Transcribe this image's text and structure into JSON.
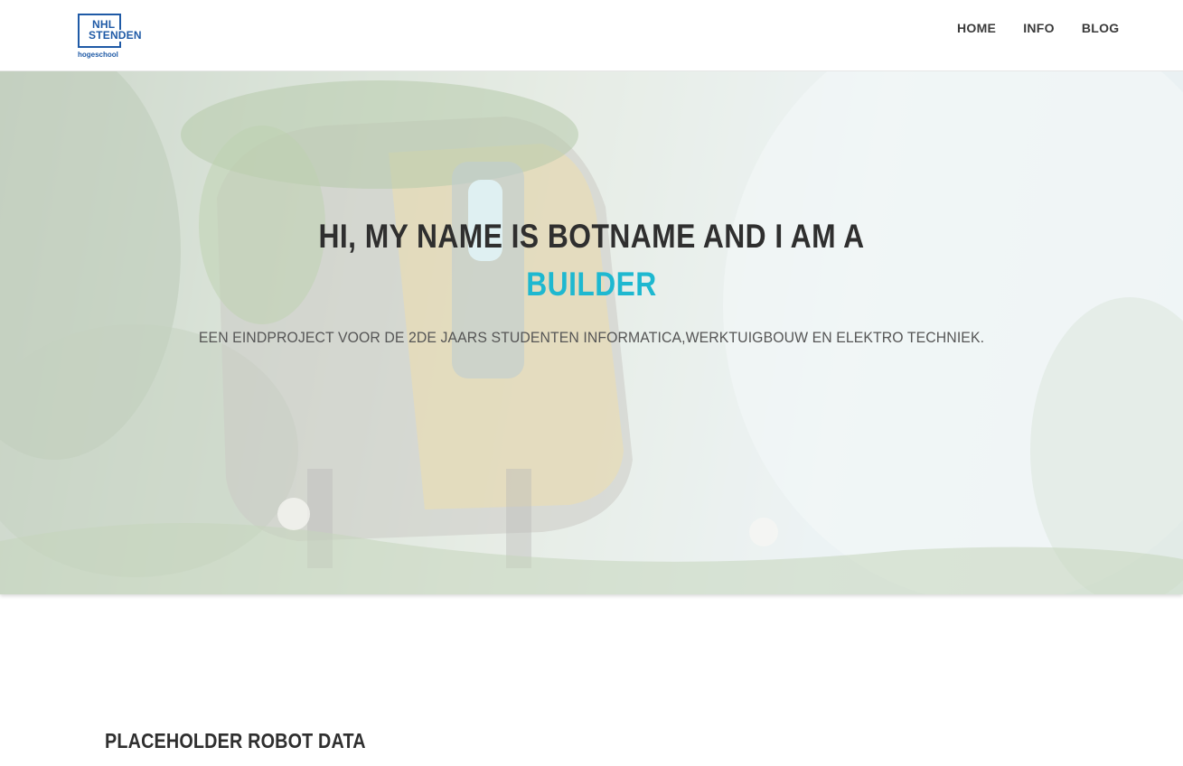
{
  "header": {
    "logo": {
      "line1": "NHL",
      "line2": "STENDEN",
      "line3": "hogeschool"
    },
    "nav": [
      {
        "label": "HOME"
      },
      {
        "label": "INFO"
      },
      {
        "label": "BLOG"
      }
    ]
  },
  "hero": {
    "title": "HI, MY NAME IS BOTNAME AND I AM A",
    "highlight": "BUILDER",
    "subtitle": "EEN EINDPROJECT VOOR DE 2DE JAARS STUDENTEN INFORMATICA,WERKTUIGBOUW EN ELEKTRO TECHNIEK.",
    "highlight_color": "#1eb8d0"
  },
  "section": {
    "title": "PLACEHOLDER ROBOT DATA"
  },
  "colors": {
    "brand": "#1f5aa6",
    "accent": "#1eb8d0",
    "text": "#2f2f2f"
  }
}
